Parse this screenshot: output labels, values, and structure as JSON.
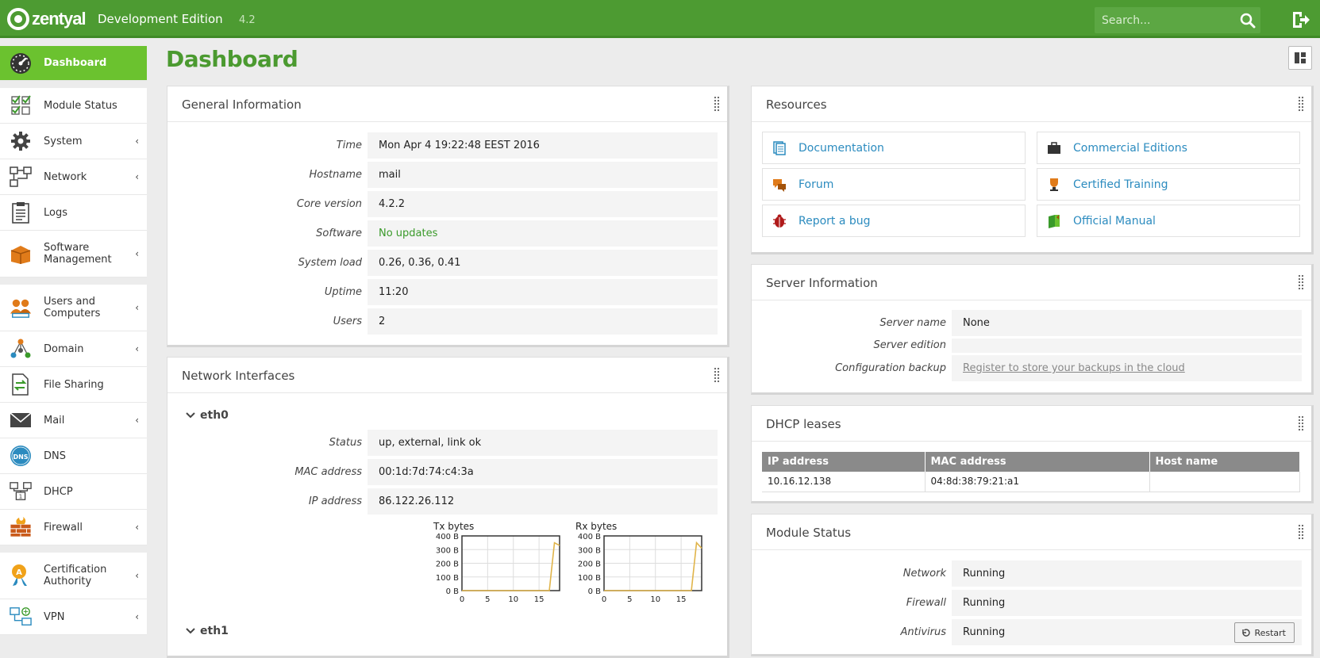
{
  "header": {
    "brand": "zentyal",
    "edition": "Development Edition",
    "version": "4.2",
    "search_placeholder": "Search..."
  },
  "sidebar": {
    "groups": [
      [
        {
          "label": "Dashboard",
          "icon": "dashboard-icon",
          "active": true
        }
      ],
      [
        {
          "label": "Module Status",
          "icon": "checklist-icon"
        },
        {
          "label": "System",
          "icon": "gear-icon",
          "chevron": true
        },
        {
          "label": "Network",
          "icon": "network-icon",
          "chevron": true
        },
        {
          "label": "Logs",
          "icon": "clipboard-icon"
        },
        {
          "label": "Software Management",
          "icon": "package-icon",
          "chevron": true
        }
      ],
      [
        {
          "label": "Users and Computers",
          "icon": "users-icon",
          "chevron": true
        },
        {
          "label": "Domain",
          "icon": "domain-icon",
          "chevron": true
        },
        {
          "label": "File Sharing",
          "icon": "file-sharing-icon"
        },
        {
          "label": "Mail",
          "icon": "mail-icon",
          "chevron": true
        },
        {
          "label": "DNS",
          "icon": "dns-icon"
        },
        {
          "label": "DHCP",
          "icon": "dhcp-icon"
        },
        {
          "label": "Firewall",
          "icon": "firewall-icon",
          "chevron": true
        }
      ],
      [
        {
          "label": "Certification Authority",
          "icon": "certificate-icon",
          "chevron": true
        },
        {
          "label": "VPN",
          "icon": "vpn-icon",
          "chevron": true
        }
      ]
    ],
    "chevron_glyph": "‹"
  },
  "page_title": "Dashboard",
  "general_info": {
    "title": "General Information",
    "rows": [
      {
        "key": "Time",
        "value": "Mon Apr 4 19:22:48 EEST 2016"
      },
      {
        "key": "Hostname",
        "value": "mail"
      },
      {
        "key": "Core version",
        "value": "4.2.2"
      },
      {
        "key": "Software",
        "value": "No updates"
      },
      {
        "key": "System load",
        "value": "0.26, 0.36, 0.41"
      },
      {
        "key": "Uptime",
        "value": "11:20"
      },
      {
        "key": "Users",
        "value": "2"
      }
    ]
  },
  "network_interfaces": {
    "title": "Network Interfaces",
    "interfaces": [
      {
        "name": "eth0",
        "rows": [
          {
            "key": "Status",
            "value": "up, external, link ok"
          },
          {
            "key": "MAC address",
            "value": "00:1d:7d:74:c4:3a"
          },
          {
            "key": "IP address",
            "value": "86.122.26.112"
          }
        ]
      },
      {
        "name": "eth1"
      }
    ]
  },
  "resources": {
    "title": "Resources",
    "links": [
      {
        "label": "Documentation",
        "icon": "document-icon"
      },
      {
        "label": "Commercial Editions",
        "icon": "briefcase-icon"
      },
      {
        "label": "Forum",
        "icon": "forum-icon"
      },
      {
        "label": "Certified Training",
        "icon": "trophy-icon"
      },
      {
        "label": "Report a bug",
        "icon": "bug-icon"
      },
      {
        "label": "Official Manual",
        "icon": "manual-icon"
      }
    ]
  },
  "server_info": {
    "title": "Server Information",
    "rows": [
      {
        "key": "Server name",
        "value": "None"
      },
      {
        "key": "Server edition",
        "value": ""
      },
      {
        "key": "Configuration backup",
        "value": "Register to store your backups in the cloud"
      }
    ]
  },
  "dhcp_leases": {
    "title": "DHCP leases",
    "columns": [
      "IP address",
      "MAC address",
      "Host name"
    ],
    "rows": [
      [
        "10.16.12.138",
        "04:8d:38:79:21:a1",
        ""
      ]
    ]
  },
  "module_status": {
    "title": "Module Status",
    "rows": [
      {
        "key": "Network",
        "value": "Running"
      },
      {
        "key": "Firewall",
        "value": "Running"
      },
      {
        "key": "Antivirus",
        "value": "Running",
        "action": "Restart"
      }
    ]
  },
  "colors": {
    "brand_green": "#4d9b32",
    "active_green": "#6bc22f",
    "link_blue": "#2b8bbf",
    "ok_green": "#3a9a2a",
    "chart_line": "#e0b44a"
  },
  "chart_data": [
    {
      "type": "line",
      "title": "Tx bytes",
      "x": [
        0,
        1,
        2,
        3,
        4,
        5,
        6,
        7,
        8,
        9,
        10,
        11,
        12,
        13,
        14,
        15,
        16,
        17,
        18,
        19
      ],
      "series": [
        {
          "values": [
            0,
            0,
            0,
            0,
            0,
            0,
            0,
            0,
            0,
            0,
            0,
            0,
            0,
            0,
            0,
            0,
            0,
            0,
            350,
            330
          ]
        }
      ],
      "xticks": [
        "0",
        "5",
        "10",
        "15"
      ],
      "yticks": [
        "0 B",
        "100 B",
        "200 B",
        "300 B",
        "400 B"
      ],
      "xlim": [
        0,
        19
      ],
      "ylim": [
        0,
        400
      ]
    },
    {
      "type": "line",
      "title": "Rx bytes",
      "x": [
        0,
        1,
        2,
        3,
        4,
        5,
        6,
        7,
        8,
        9,
        10,
        11,
        12,
        13,
        14,
        15,
        16,
        17,
        18,
        19
      ],
      "series": [
        {
          "values": [
            0,
            0,
            0,
            0,
            0,
            0,
            0,
            0,
            0,
            0,
            0,
            0,
            0,
            0,
            0,
            0,
            0,
            0,
            350,
            310
          ]
        }
      ],
      "xticks": [
        "0",
        "5",
        "10",
        "15"
      ],
      "yticks": [
        "0 B",
        "100 B",
        "200 B",
        "300 B",
        "400 B"
      ],
      "xlim": [
        0,
        19
      ],
      "ylim": [
        0,
        400
      ]
    }
  ]
}
